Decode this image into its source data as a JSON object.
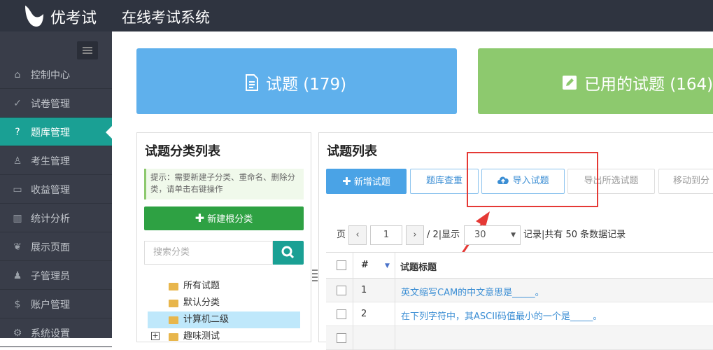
{
  "header": {
    "brand": "优考试",
    "system_title": "在线考试系统"
  },
  "sidebar": {
    "items": [
      {
        "label": "控制中心",
        "icon": "home-icon"
      },
      {
        "label": "试卷管理",
        "icon": "check-circle-icon"
      },
      {
        "label": "题库管理",
        "icon": "question-circle-icon",
        "active": true
      },
      {
        "label": "考生管理",
        "icon": "user-icon"
      },
      {
        "label": "收益管理",
        "icon": "card-icon"
      },
      {
        "label": "统计分析",
        "icon": "bar-chart-icon"
      },
      {
        "label": "展示页面",
        "icon": "leaf-icon"
      },
      {
        "label": "子管理员",
        "icon": "users-icon"
      },
      {
        "label": "账户管理",
        "icon": "dollar-icon"
      },
      {
        "label": "系统设置",
        "icon": "gear-icon"
      }
    ]
  },
  "stats": {
    "questions": "试题 (179)",
    "used_questions": "已用的试题 (164)"
  },
  "category_panel": {
    "title": "试题分类列表",
    "tip": "提示：需要新建子分类、重命名、删除分类，请单击右键操作",
    "new_root_button": "新建根分类",
    "search_placeholder": "搜索分类",
    "tree": [
      {
        "label": "所有试题"
      },
      {
        "label": "默认分类"
      },
      {
        "label": "计算机二级",
        "selected": true
      },
      {
        "label": "趣味测试"
      }
    ]
  },
  "question_panel": {
    "title": "试题列表",
    "toolbar": {
      "add": "新增试题",
      "dedupe": "题库查重",
      "import": "导入试题",
      "export": "导出所选试题",
      "move": "移动到分"
    },
    "pager": {
      "page_label": "页",
      "current_page": "1",
      "total_label": "/ 2|显示",
      "page_size": "30",
      "summary": "记录|共有 50 条数据记录"
    },
    "table": {
      "headers": [
        "#",
        "试题标题"
      ],
      "rows": [
        {
          "num": "1",
          "title": "英文缩写CAM的中文意思是_____。"
        },
        {
          "num": "2",
          "title": "在下列字符中，其ASCII码值最小的一个是_____。"
        }
      ]
    }
  },
  "colors": {
    "sidebar": "#393d49",
    "active": "#1aa094",
    "card_blue": "#5fb0ec",
    "card_green": "#8dc96e",
    "annotation_red": "#e53935"
  }
}
